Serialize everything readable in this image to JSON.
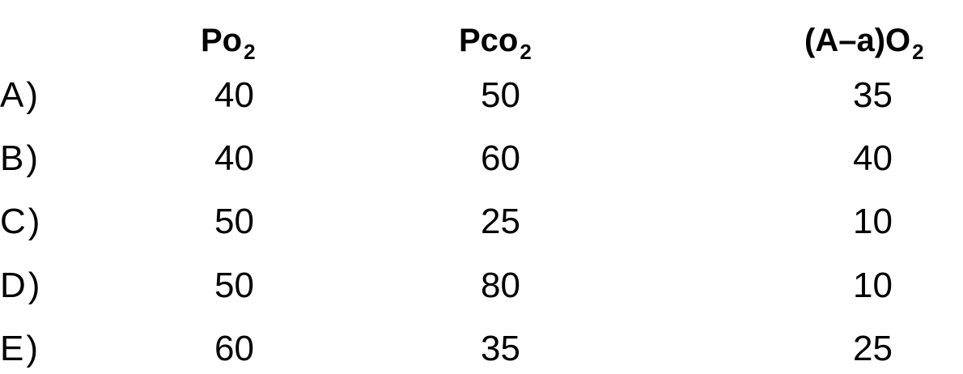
{
  "headers": {
    "po2_base": "Po",
    "po2_sub": "2",
    "pco2_base": "Pco",
    "pco2_sub": "2",
    "aa_base": "(A–a)O",
    "aa_sub": "2"
  },
  "rows": [
    {
      "label": "A)",
      "po2": "40",
      "pco2": "50",
      "aa": "35"
    },
    {
      "label": "B)",
      "po2": "40",
      "pco2": "60",
      "aa": "40"
    },
    {
      "label": "C)",
      "po2": "50",
      "pco2": "25",
      "aa": "10"
    },
    {
      "label": "D)",
      "po2": "50",
      "pco2": "80",
      "aa": "10"
    },
    {
      "label": "E)",
      "po2": "60",
      "pco2": "35",
      "aa": "25"
    }
  ]
}
